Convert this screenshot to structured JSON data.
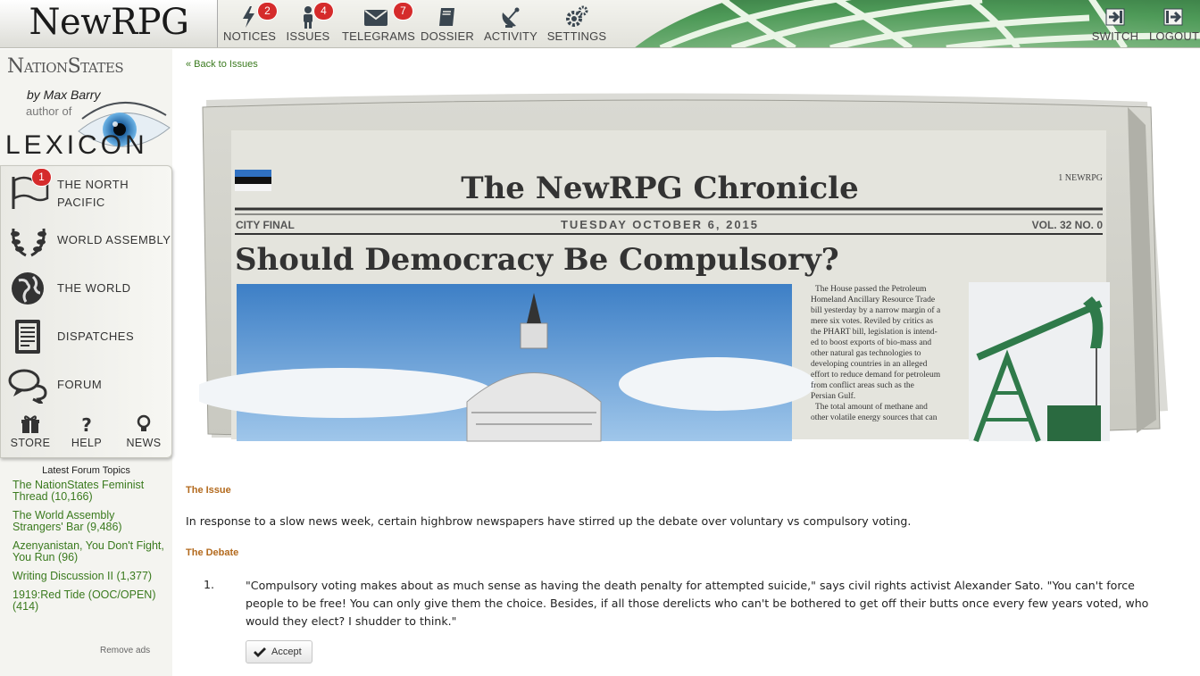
{
  "header": {
    "logo": "NewRPG",
    "nav": [
      {
        "label": "NOTICES",
        "icon": "lightning-icon",
        "badge": "2"
      },
      {
        "label": "ISSUES",
        "icon": "person-icon",
        "badge": "4"
      },
      {
        "label": "TELEGRAMS",
        "icon": "envelope-icon",
        "badge": "7"
      },
      {
        "label": "DOSSIER",
        "icon": "book-icon",
        "badge": ""
      },
      {
        "label": "ACTIVITY",
        "icon": "satellite-dish-icon",
        "badge": ""
      },
      {
        "label": "SETTINGS",
        "icon": "gears-icon",
        "badge": ""
      }
    ],
    "right": [
      {
        "label": "SWITCH",
        "icon": "switch-icon"
      },
      {
        "label": "LOGOUT",
        "icon": "logout-icon"
      }
    ]
  },
  "sidebar": {
    "site_title": "NationStates",
    "author_line": "by Max Barry",
    "author_of": "author of",
    "book": "LEXICON",
    "items": [
      {
        "label_1": "THE NORTH",
        "label_2": "PACIFIC",
        "icon": "flag-icon",
        "badge": "1"
      },
      {
        "label_1": "WORLD ASSEMBLY",
        "icon": "laurel-icon"
      },
      {
        "label_1": "THE WORLD",
        "icon": "globe-icon"
      },
      {
        "label_1": "DISPATCHES",
        "icon": "document-icon"
      },
      {
        "label_1": "FORUM",
        "icon": "speech-bubbles-icon"
      }
    ],
    "mini": [
      {
        "label": "STORE",
        "icon": "gift-icon"
      },
      {
        "label": "HELP",
        "icon": "question-icon"
      },
      {
        "label": "NEWS",
        "icon": "lightbulb-icon"
      }
    ],
    "forum": {
      "title": "Latest Forum Topics",
      "topics": [
        "The NationStates Feminist Thread (10,166)",
        "The World Assembly Strangers' Bar (9,486)",
        "Azenyanistan, You Don't Fight, You Run (96)",
        "Writing Discussion II (1,377)",
        "1919:Red Tide (OOC/OPEN) (414)"
      ]
    },
    "remove_ads": "Remove ads"
  },
  "main": {
    "back": "« Back to Issues",
    "newspaper": {
      "masthead": "The NewRPG Chronicle",
      "price": "1 NEWRPG",
      "edition": "CITY FINAL",
      "date": "TUESDAY OCTOBER 6, 2015",
      "volume": "VOL. 32 NO. 0",
      "headline": "Should Democracy Be Compulsory?",
      "column_lines": [
        "The House passed the Petroleum",
        "Homeland Ancillary Resource Trade",
        "bill yesterday by a narrow margin of a",
        "mere six votes. Reviled by critics as",
        "the PHART bill, legislation is intend-",
        "ed to boost exports of bio-mass and",
        "other natural gas technologies to",
        "developing countries in an alleged",
        "effort to reduce demand for petroleum",
        "from conflict areas such as the",
        "Persian Gulf.",
        "The total amount of methane and",
        "other volatile energy sources that can"
      ]
    },
    "issue_heading": "The Issue",
    "issue_text": "In response to a slow news week, certain highbrow newspapers have stirred up the debate over voluntary vs compulsory voting.",
    "debate_heading": "The Debate",
    "options": [
      {
        "number": "1.",
        "text": "\"Compulsory voting makes about as much sense as having the death penalty for attempted suicide,\" says civil rights activist Alexander Sato. \"You can't force people to be free! You can only give them the choice. Besides, if all those derelicts who can't be bothered to get off their butts once every few years voted, who would they elect? I shudder to think.\"",
        "button": "Accept"
      }
    ]
  },
  "colors": {
    "link_green": "#3a7a1e",
    "heading_orange": "#b36a1e",
    "badge_red": "#d52b2b",
    "globe_green": "#3f8a4f"
  }
}
